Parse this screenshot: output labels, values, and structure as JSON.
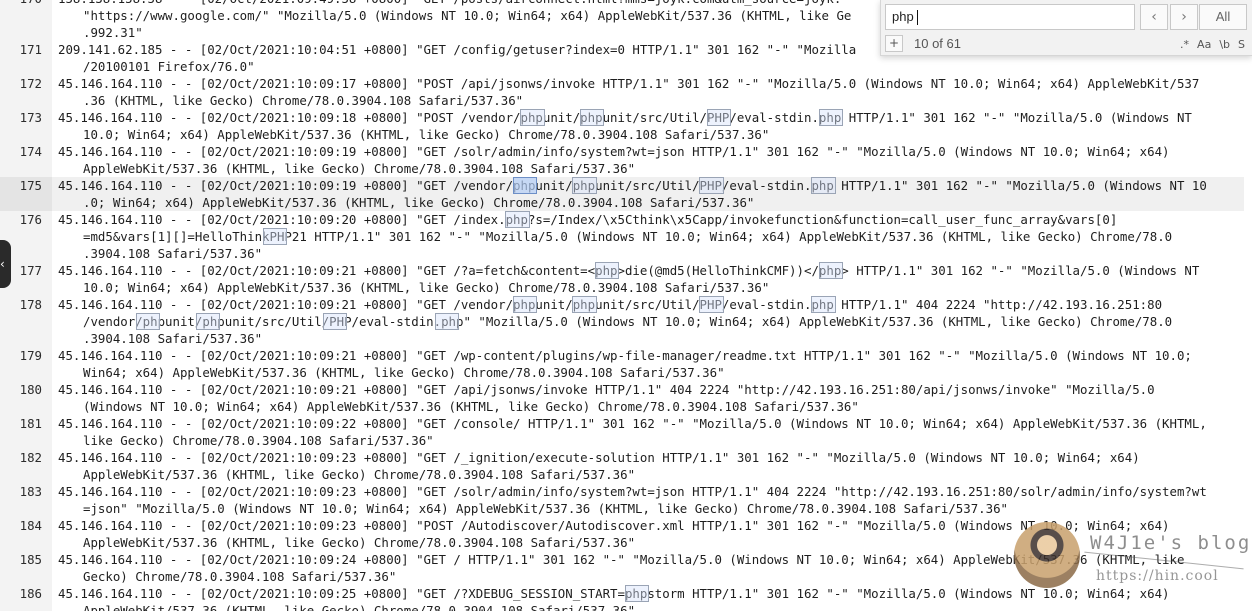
{
  "editor": {
    "active_line": "175",
    "lines": [
      {
        "num": "170",
        "rows": [
          "158.138.158.58 - - [02/Oct/2021:09:49:58 +0800] \"GET /posts/airconnect.html?mms=joyk.com&utm_source=joyk.",
          "\"https://www.google.com/\" \"Mozilla/5.0 (Windows NT 10.0; Win64; x64) AppleWebKit/537.36 (KHTML, like Ge",
          ".992.31\""
        ]
      },
      {
        "num": "171",
        "rows": [
          "209.141.62.185 - - [02/Oct/2021:10:04:51 +0800] \"GET /config/getuser?index=0 HTTP/1.1\" 301 162 \"-\" \"Mozilla",
          "/20100101 Firefox/76.0\""
        ]
      },
      {
        "num": "172",
        "rows": [
          "45.146.164.110 - - [02/Oct/2021:10:09:17 +0800] \"POST /api/jsonws/invoke HTTP/1.1\" 301 162 \"-\" \"Mozilla/5.0 (Windows NT 10.0; Win64; x64) AppleWebKit/537",
          ".36 (KHTML, like Gecko) Chrome/78.0.3904.108 Safari/537.36\""
        ]
      },
      {
        "num": "173",
        "rows": [
          "45.146.164.110 - - [02/Oct/2021:10:09:18 +0800] \"POST /vendor/phpunit/phpunit/src/Util/PHP/eval-stdin.php HTTP/1.1\" 301 162 \"-\" \"Mozilla/5.0 (Windows NT",
          "10.0; Win64; x64) AppleWebKit/537.36 (KHTML, like Gecko) Chrome/78.0.3904.108 Safari/537.36\""
        ]
      },
      {
        "num": "174",
        "rows": [
          "45.146.164.110 - - [02/Oct/2021:10:09:19 +0800] \"GET /solr/admin/info/system?wt=json HTTP/1.1\" 301 162 \"-\" \"Mozilla/5.0 (Windows NT 10.0; Win64; x64)",
          "AppleWebKit/537.36 (KHTML, like Gecko) Chrome/78.0.3904.108 Safari/537.36\""
        ]
      },
      {
        "num": "175",
        "rows": [
          "45.146.164.110 - - [02/Oct/2021:10:09:19 +0800] \"GET /vendor/phpunit/phpunit/src/Util/PHP/eval-stdin.php HTTP/1.1\" 301 162 \"-\" \"Mozilla/5.0 (Windows NT 10",
          ".0; Win64; x64) AppleWebKit/537.36 (KHTML, like Gecko) Chrome/78.0.3904.108 Safari/537.36\""
        ]
      },
      {
        "num": "176",
        "rows": [
          "45.146.164.110 - - [02/Oct/2021:10:09:20 +0800] \"GET /index.php?s=/Index/\\x5Cthink\\x5Capp/invokefunction&function=call_user_func_array&vars[0]",
          "=md5&vars[1][]=HelloThinkPHP21 HTTP/1.1\" 301 162 \"-\" \"Mozilla/5.0 (Windows NT 10.0; Win64; x64) AppleWebKit/537.36 (KHTML, like Gecko) Chrome/78.0",
          ".3904.108 Safari/537.36\""
        ]
      },
      {
        "num": "177",
        "rows": [
          "45.146.164.110 - - [02/Oct/2021:10:09:21 +0800] \"GET /?a=fetch&content=<php>die(@md5(HelloThinkCMF))</php> HTTP/1.1\" 301 162 \"-\" \"Mozilla/5.0 (Windows NT",
          "10.0; Win64; x64) AppleWebKit/537.36 (KHTML, like Gecko) Chrome/78.0.3904.108 Safari/537.36\""
        ]
      },
      {
        "num": "178",
        "rows": [
          "45.146.164.110 - - [02/Oct/2021:10:09:21 +0800] \"GET /vendor/phpunit/phpunit/src/Util/PHP/eval-stdin.php HTTP/1.1\" 404 2224 \"http://42.193.16.251:80",
          "/vendor/phpunit/phpunit/src/Util/PHP/eval-stdin.php\" \"Mozilla/5.0 (Windows NT 10.0; Win64; x64) AppleWebKit/537.36 (KHTML, like Gecko) Chrome/78.0",
          ".3904.108 Safari/537.36\""
        ]
      },
      {
        "num": "179",
        "rows": [
          "45.146.164.110 - - [02/Oct/2021:10:09:21 +0800] \"GET /wp-content/plugins/wp-file-manager/readme.txt HTTP/1.1\" 301 162 \"-\" \"Mozilla/5.0 (Windows NT 10.0;",
          "Win64; x64) AppleWebKit/537.36 (KHTML, like Gecko) Chrome/78.0.3904.108 Safari/537.36\""
        ]
      },
      {
        "num": "180",
        "rows": [
          "45.146.164.110 - - [02/Oct/2021:10:09:21 +0800] \"GET /api/jsonws/invoke HTTP/1.1\" 404 2224 \"http://42.193.16.251:80/api/jsonws/invoke\" \"Mozilla/5.0",
          "(Windows NT 10.0; Win64; x64) AppleWebKit/537.36 (KHTML, like Gecko) Chrome/78.0.3904.108 Safari/537.36\""
        ]
      },
      {
        "num": "181",
        "rows": [
          "45.146.164.110 - - [02/Oct/2021:10:09:22 +0800] \"GET /console/ HTTP/1.1\" 301 162 \"-\" \"Mozilla/5.0 (Windows NT 10.0; Win64; x64) AppleWebKit/537.36 (KHTML,",
          "like Gecko) Chrome/78.0.3904.108 Safari/537.36\""
        ]
      },
      {
        "num": "182",
        "rows": [
          "45.146.164.110 - - [02/Oct/2021:10:09:23 +0800] \"GET /_ignition/execute-solution HTTP/1.1\" 301 162 \"-\" \"Mozilla/5.0 (Windows NT 10.0; Win64; x64)",
          "AppleWebKit/537.36 (KHTML, like Gecko) Chrome/78.0.3904.108 Safari/537.36\""
        ]
      },
      {
        "num": "183",
        "rows": [
          "45.146.164.110 - - [02/Oct/2021:10:09:23 +0800] \"GET /solr/admin/info/system?wt=json HTTP/1.1\" 404 2224 \"http://42.193.16.251:80/solr/admin/info/system?wt",
          "=json\" \"Mozilla/5.0 (Windows NT 10.0; Win64; x64) AppleWebKit/537.36 (KHTML, like Gecko) Chrome/78.0.3904.108 Safari/537.36\""
        ]
      },
      {
        "num": "184",
        "rows": [
          "45.146.164.110 - - [02/Oct/2021:10:09:23 +0800] \"POST /Autodiscover/Autodiscover.xml HTTP/1.1\" 301 162 \"-\" \"Mozilla/5.0 (Windows NT 10.0; Win64; x64)",
          "AppleWebKit/537.36 (KHTML, like Gecko) Chrome/78.0.3904.108 Safari/537.36\""
        ]
      },
      {
        "num": "185",
        "rows": [
          "45.146.164.110 - - [02/Oct/2021:10:09:24 +0800] \"GET / HTTP/1.1\" 301 162 \"-\" \"Mozilla/5.0 (Windows NT 10.0; Win64; x64) AppleWebKit/537.36 (KHTML, like",
          "Gecko) Chrome/78.0.3904.108 Safari/537.36\""
        ]
      },
      {
        "num": "186",
        "rows": [
          "45.146.164.110 - - [02/Oct/2021:10:09:25 +0800] \"GET /?XDEBUG_SESSION_START=phpstorm HTTP/1.1\" 301 162 \"-\" \"Mozilla/5.0 (Windows NT 10.0; Win64; x64)",
          "AppleWebKit/537.36 (KHTML, like Gecko) Chrome/78.0.3904.108 Safari/537.36\""
        ]
      }
    ]
  },
  "find": {
    "query": "php",
    "match_count": "10 of 61",
    "prev_icon": "chevron-left-icon",
    "next_icon": "chevron-right-icon",
    "prev_label": "‹",
    "next_label": "›",
    "all_label": "All",
    "expand_label": "+",
    "options": [
      {
        "name": "regex-toggle",
        "label": ".*"
      },
      {
        "name": "case-toggle",
        "label": "Aa"
      },
      {
        "name": "word-toggle",
        "label": "\\b"
      },
      {
        "name": "selection-toggle",
        "label": "S"
      }
    ]
  },
  "side_tab": {
    "label": "‹",
    "icon": "chevron-left-icon"
  },
  "watermark": {
    "name": "W4J1e's blog",
    "url": "https://hin.cool"
  },
  "colors": {
    "highlight_border": "#9aa4b5",
    "current_match": "#b4cdf5",
    "active_line": "#f0f0f0"
  }
}
